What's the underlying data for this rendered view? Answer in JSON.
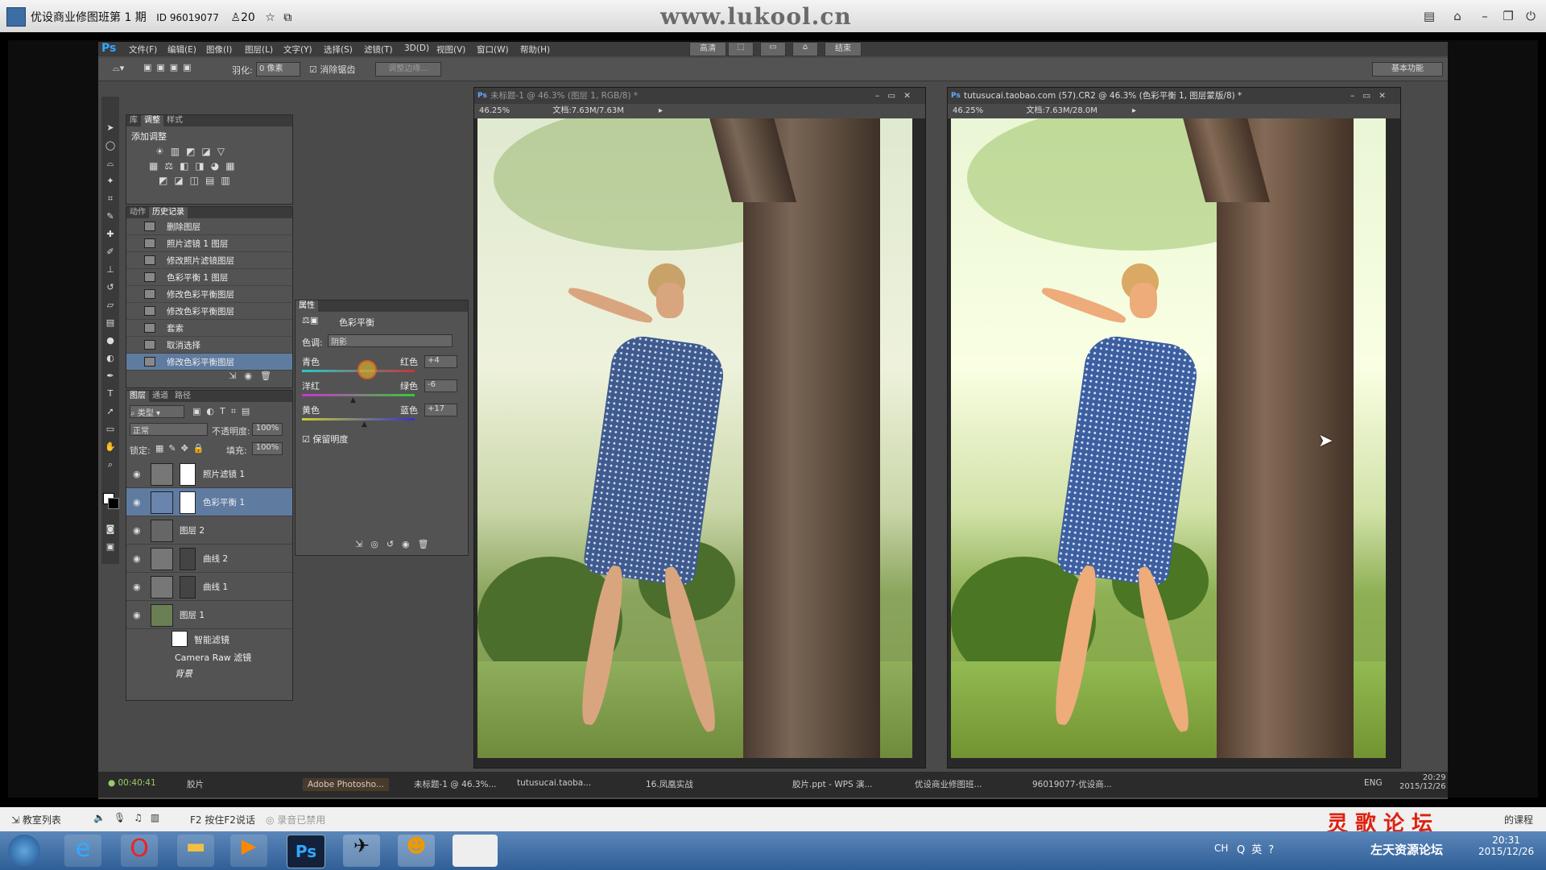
{
  "window": {
    "title": "优设商业修图班第 1 期",
    "id": "ID 96019077",
    "users": "20",
    "watermark": "www.lukool.cn"
  },
  "menubar": {
    "items": [
      "文件(F)",
      "编辑(E)",
      "图像(I)",
      "图层(L)",
      "文字(Y)",
      "选择(S)",
      "滤镜(T)",
      "3D(D)",
      "视图(V)",
      "窗口(W)",
      "帮助(H)"
    ],
    "right_buttons": [
      "高清",
      "结束"
    ]
  },
  "options": {
    "feather_label": "羽化:",
    "feather_value": "0 像素",
    "antialias": "消除锯齿",
    "refine_edge": "调整边缘...",
    "workspace": "基本功能"
  },
  "adjust_panel": {
    "tabs": [
      "库",
      "调整",
      "样式"
    ],
    "heading": "添加调整"
  },
  "history_panel": {
    "tabs": [
      "动作",
      "历史记录"
    ],
    "items": [
      "删除图层",
      "照片滤镜 1 图层",
      "修改照片滤镜图层",
      "色彩平衡 1 图层",
      "修改色彩平衡图层",
      "修改色彩平衡图层",
      "套索",
      "取消选择",
      "修改色彩平衡图层"
    ],
    "selected_index": 8
  },
  "layers_panel": {
    "tabs": [
      "图层",
      "通道",
      "路径"
    ],
    "filter": "类型",
    "blend": "正常",
    "opacity_label": "不透明度:",
    "opacity": "100%",
    "lock_label": "锁定:",
    "fill_label": "填充:",
    "fill": "100%",
    "layers": [
      {
        "name": "照片滤镜 1",
        "selected": false
      },
      {
        "name": "色彩平衡 1",
        "selected": true
      },
      {
        "name": "图层 2",
        "selected": false
      },
      {
        "name": "曲线 2",
        "selected": false
      },
      {
        "name": "曲线 1",
        "selected": false
      },
      {
        "name": "图层 1",
        "selected": false
      }
    ],
    "smart_filter": "智能滤镜",
    "camera_raw": "Camera Raw 滤镜",
    "background": "背景"
  },
  "properties_panel": {
    "tab": "属性",
    "title": "色彩平衡",
    "tone_label": "色调:",
    "tone": "阴影",
    "sliders": [
      {
        "left": "青色",
        "right": "红色",
        "value": "+4",
        "pos": 0.52
      },
      {
        "left": "洋红",
        "right": "绿色",
        "value": "-6",
        "pos": 0.46
      },
      {
        "left": "黄色",
        "right": "蓝色",
        "value": "+17",
        "pos": 0.57
      }
    ],
    "preserve": "保留明度"
  },
  "documents": [
    {
      "title": "未标题-1 @ 46.3% (图层 1, RGB/8) *",
      "zoom": "46.25%",
      "doc": "文档:7.63M/7.63M"
    },
    {
      "title": "tutusucai.taobao.com (57).CR2 @ 46.3% (色彩平衡 1, 图层蒙版/8) *",
      "zoom": "46.25%",
      "doc": "文档:7.63M/28.0M"
    }
  ],
  "ps_taskbar": {
    "timer": "00:40:41",
    "items": [
      "胶片",
      "Adobe Photosho...",
      "未标题-1 @ 46.3%...",
      "tutusucai.taoba...",
      "16.凤凰实战",
      "胶片.ppt - WPS 演...",
      "优设商业修图班...",
      "96019077-优设商..."
    ],
    "lang": "ENG",
    "time": "20:29",
    "date": "2015/12/26"
  },
  "recbar": {
    "class_list": "教室列表",
    "f2": "按住F2说话",
    "recording": "录音已禁用",
    "forum": "灵 歌 论 坛",
    "course": "的课程"
  },
  "win_taskbar": {
    "lang": "CH",
    "ime": "英",
    "notice": "左天资源论坛",
    "time": "20:31",
    "date": "2015/12/26"
  }
}
